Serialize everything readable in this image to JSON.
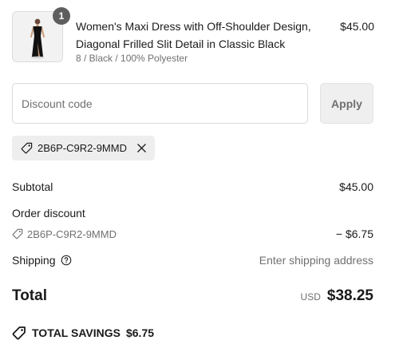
{
  "product": {
    "quantity": "1",
    "name": "Women's Maxi Dress with Off-Shoulder Design, Diagonal Frilled Slit Detail in Classic Black",
    "variant": "8 / Black / 100% Polyester",
    "price": "$45.00",
    "image_icon": "product-thumbnail"
  },
  "discount": {
    "placeholder": "Discount code",
    "value": "",
    "apply_label": "Apply",
    "applied_code": "2B6P-C9R2-9MMD"
  },
  "summary": {
    "subtotal_label": "Subtotal",
    "subtotal_value": "$45.00",
    "order_discount_label": "Order discount",
    "discount_code": "2B6P-C9R2-9MMD",
    "discount_value": "− $6.75",
    "shipping_label": "Shipping",
    "shipping_value": "Enter shipping address",
    "total_label": "Total",
    "currency": "USD",
    "total_value": "$38.25",
    "savings_label": "TOTAL SAVINGS",
    "savings_value": "$6.75"
  },
  "colors": {
    "text": "#1a1a1a",
    "muted": "#707070",
    "border": "#d9d9d9",
    "chip_bg": "#eeeeee",
    "badge_bg": "#5e5e5e"
  },
  "icons": [
    "tag-icon",
    "close-icon",
    "help-icon",
    "savings-tag-icon"
  ]
}
